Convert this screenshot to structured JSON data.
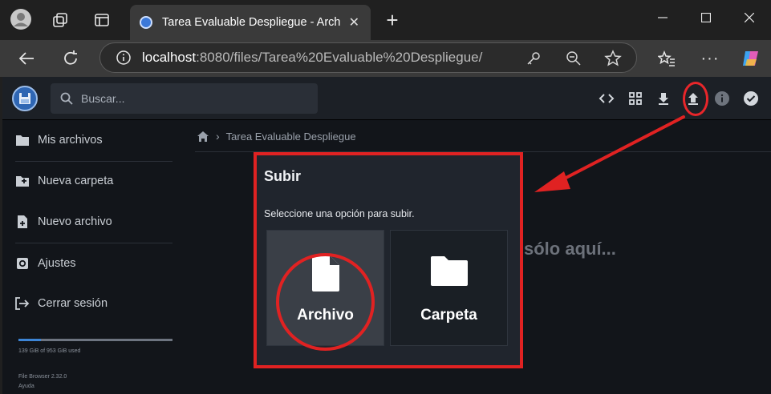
{
  "browser": {
    "tab_title": "Tarea Evaluable Despliegue - Archivos",
    "url_host": "localhost",
    "url_rest": ":8080/files/Tarea%20Evaluable%20Despliegue/"
  },
  "app": {
    "search_placeholder": "Buscar...",
    "header_buttons": [
      "code-icon",
      "grid-view-icon",
      "download-icon",
      "upload-icon",
      "info-icon",
      "check-circle-icon"
    ],
    "sidebar": {
      "items": [
        {
          "label": "Mis archivos",
          "icon": "folder-icon"
        },
        {
          "label": "Nueva carpeta",
          "icon": "folder-plus-icon"
        },
        {
          "label": "Nuevo archivo",
          "icon": "file-plus-icon"
        },
        {
          "label": "Ajustes",
          "icon": "settings-icon"
        },
        {
          "label": "Cerrar sesión",
          "icon": "logout-icon"
        }
      ],
      "usage_text": "139 GiB of 953 GiB used",
      "usage_fraction": 0.146,
      "version": "File Browser 2.32.0",
      "help": "Ayuda"
    },
    "breadcrumb": {
      "folder": "Tarea Evaluable Despliegue"
    },
    "background_text": "sólo aquí..."
  },
  "dialog": {
    "title": "Subir",
    "subtitle": "Seleccione una opción para subir.",
    "options": [
      {
        "label": "Archivo",
        "icon": "file-icon"
      },
      {
        "label": "Carpeta",
        "icon": "folder-icon"
      }
    ]
  },
  "colors": {
    "annotation_red": "#e02222",
    "accent_blue": "#3d85d6"
  }
}
